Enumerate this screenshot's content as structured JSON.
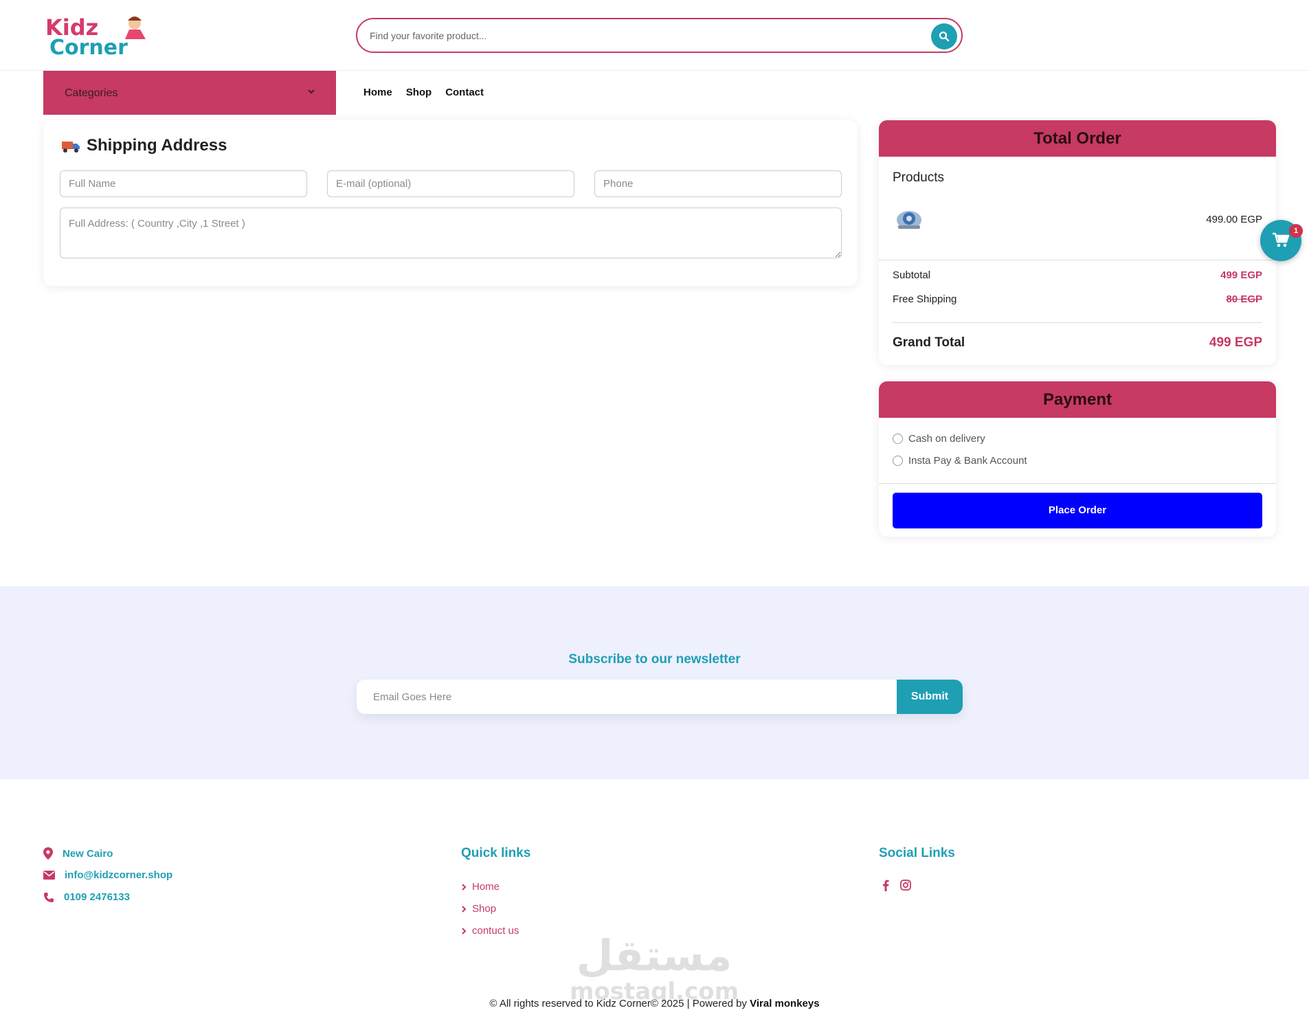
{
  "brand": {
    "logo_line1": "Kidz",
    "logo_line2": "Corner",
    "primary_color": "#c63a63",
    "accent_color": "#1e9fb3",
    "button_color": "#0000ff",
    "newsletter_bg": "#eef0fd"
  },
  "header": {
    "search_placeholder": "Find your favorite product...",
    "search_icon": "search-icon"
  },
  "nav": {
    "categories_label": "Categories",
    "links": [
      "Home",
      "Shop",
      "Contact"
    ]
  },
  "shipping": {
    "title": "Shipping Address",
    "icon": "truck-icon",
    "full_name_placeholder": "Full Name",
    "email_placeholder": "E-mail (optional)",
    "phone_placeholder": "Phone",
    "address_placeholder": "Full Address: ( Country ,City ,1 Street )"
  },
  "order": {
    "title": "Total Order",
    "products_label": "Products",
    "product_price": "499.00 EGP",
    "subtotal_label": "Subtotal",
    "subtotal_value": "499 EGP",
    "shipping_label": "Free Shipping",
    "shipping_value": "80 EGP",
    "grand_total_label": "Grand Total",
    "grand_total_value": "499 EGP"
  },
  "payment": {
    "title": "Payment",
    "options": [
      "Cash on delivery",
      "Insta Pay & Bank Account"
    ],
    "place_order_label": "Place Order"
  },
  "cart": {
    "count": "1",
    "icon": "cart-icon"
  },
  "newsletter": {
    "title": "Subscribe to our newsletter",
    "email_placeholder": "Email Goes Here",
    "submit_label": "Submit"
  },
  "footer": {
    "contact": {
      "location": "New Cairo",
      "email": "info@kidzcorner.shop",
      "phone": "0109 2476133"
    },
    "quick_links_title": "Quick links",
    "quick_links": [
      "Home",
      "Shop",
      "contuct us"
    ],
    "social_title": "Social Links",
    "social_icons": [
      "facebook-icon",
      "instagram-icon"
    ],
    "copyright_text": "© All rights reserved to Kidz Corner© 2025 | Powered by",
    "powered_by": "Viral monkeys",
    "watermark_arabic": "مستقل",
    "watermark_latin": "mostaql.com"
  }
}
